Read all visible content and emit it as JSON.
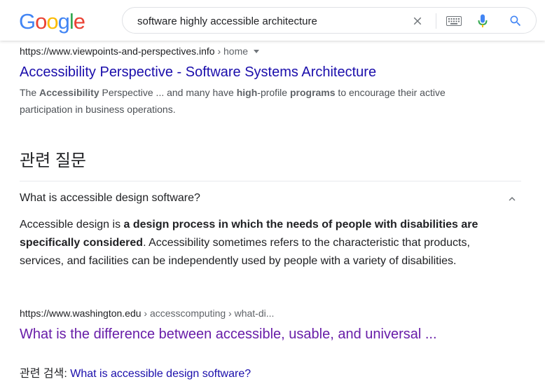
{
  "logo": {
    "letters": [
      "G",
      "o",
      "o",
      "g",
      "l",
      "e"
    ],
    "colors": [
      "#4285f4",
      "#ea4335",
      "#fbbc05",
      "#4285f4",
      "#34a853",
      "#ea4335"
    ]
  },
  "search": {
    "query": "software highly accessible architecture"
  },
  "icons": {
    "clear": "close-icon",
    "keyboard": "keyboard-icon",
    "voice": "microphone-icon",
    "search": "search-icon"
  },
  "result1": {
    "url": "https://www.viewpoints-and-perspectives.info",
    "breadcrumb": " › home",
    "title": "Accessibility Perspective - Software Systems Architecture",
    "snippet_parts": [
      "The ",
      "Accessibility",
      " Perspective ... and many have ",
      "high",
      "-profile ",
      "programs",
      " to encourage their active participation in business operations."
    ]
  },
  "paa": {
    "heading": "관련 질문",
    "question": "What is accessible design software?",
    "answer_parts": [
      "Accessible design is ",
      "a design process in which the needs of people with disabilities are specifically considered",
      ". Accessibility sometimes refers to the characteristic that products, services, and facilities can be independently used by people with a variety of disabilities."
    ]
  },
  "result2": {
    "url": "https://www.washington.edu",
    "breadcrumb": " › accesscomputing › what-di...",
    "title": "What is the difference between accessible, usable, and universal ..."
  },
  "related": {
    "label": "관련 검색:",
    "link": "What is accessible design software?"
  },
  "colors": {
    "link": "#1a0dab",
    "visited": "#681da8",
    "text": "#202124",
    "muted": "#4d5156"
  }
}
